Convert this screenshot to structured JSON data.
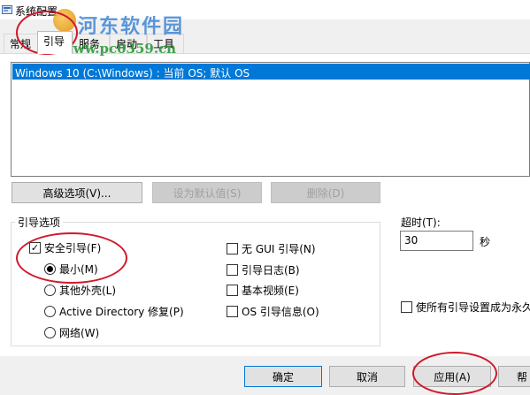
{
  "window": {
    "title": "系统配置",
    "title_icon": "msconfig-icon"
  },
  "watermark": {
    "title": "河东软件园",
    "url": "www.pc0359.cn"
  },
  "tabs": [
    {
      "label": "常规",
      "active": false
    },
    {
      "label": "引导",
      "active": true
    },
    {
      "label": "服务",
      "active": false
    },
    {
      "label": "启动",
      "active": false
    },
    {
      "label": "工具",
      "active": false
    }
  ],
  "os_list": {
    "items": [
      "Windows 10 (C:\\Windows) : 当前 OS; 默认 OS"
    ],
    "selected_index": 0
  },
  "os_buttons": {
    "advanced": "高级选项(V)...",
    "set_default": "设为默认值(S)",
    "delete": "删除(D)"
  },
  "boot_options": {
    "group_label": "引导选项",
    "safe_boot": {
      "label": "安全引导(F)",
      "checked": true
    },
    "minimal": {
      "label": "最小(M)",
      "selected": true
    },
    "alternate_shell": {
      "label": "其他外壳(L)",
      "selected": false
    },
    "active_directory": {
      "label": "Active Directory 修复(P)",
      "selected": false
    },
    "network": {
      "label": "网络(W)",
      "selected": false
    },
    "no_gui": {
      "label": "无 GUI 引导(N)",
      "checked": false
    },
    "boot_log": {
      "label": "引导日志(B)",
      "checked": false
    },
    "base_video": {
      "label": "基本视频(E)",
      "checked": false
    },
    "os_boot_info": {
      "label": "OS 引导信息(O)",
      "checked": false
    }
  },
  "timeout": {
    "label": "超时(T):",
    "value": "30",
    "unit": "秒"
  },
  "permanent": {
    "label": "使所有引导设置成为永久",
    "checked": false
  },
  "footer": {
    "ok": "确定",
    "cancel": "取消",
    "apply": "应用(A)",
    "help": "帮"
  },
  "colors": {
    "selection": "#0078d7",
    "annotation": "#d0182a"
  }
}
